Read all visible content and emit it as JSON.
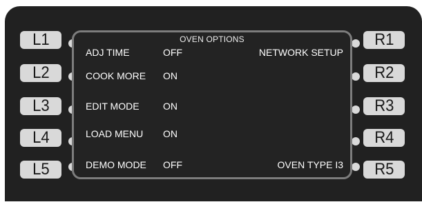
{
  "screen": {
    "title": "OVEN OPTIONS",
    "rows": [
      {
        "label": "ADJ TIME",
        "value": "OFF"
      },
      {
        "label": "COOK MORE",
        "value": "ON"
      },
      {
        "label": "EDIT MODE",
        "value": "ON"
      },
      {
        "label": "LOAD MENU",
        "value": "ON"
      },
      {
        "label": "DEMO MODE",
        "value": "OFF"
      }
    ],
    "right_items": {
      "r1": "NETWORK SETUP",
      "r5": "OVEN TYPE I3"
    }
  },
  "buttons": {
    "left": [
      "L1",
      "L2",
      "L3",
      "L4",
      "L5"
    ],
    "right": [
      "R1",
      "R2",
      "R3",
      "R4",
      "R5"
    ]
  },
  "colors": {
    "panel": "#212121",
    "button": "#d9d9d9",
    "screen_border": "#7d7d7d",
    "text": "#ffffff"
  }
}
